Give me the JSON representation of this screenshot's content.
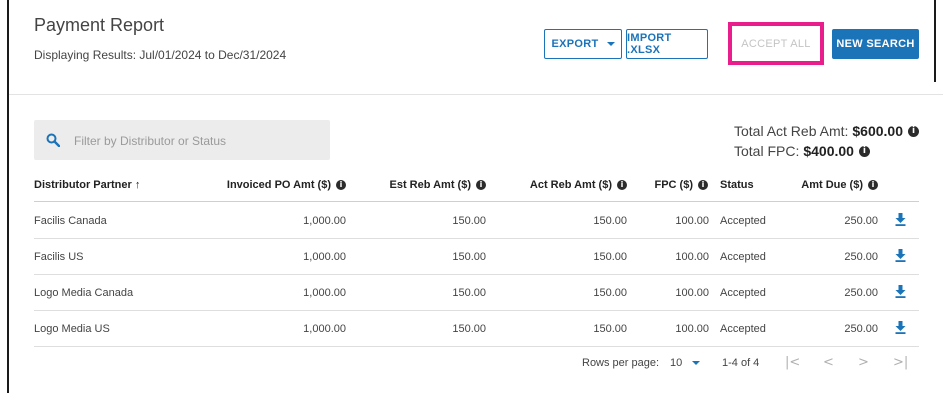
{
  "header": {
    "title": "Payment Report",
    "subtitle": "Displaying Results: Jul/01/2024 to Dec/31/2024"
  },
  "toolbar": {
    "export_label": "EXPORT",
    "import_label": "IMPORT .XLSX",
    "accept_all_label": "ACCEPT ALL",
    "new_search_label": "NEW SEARCH"
  },
  "search": {
    "placeholder": "Filter by Distributor or Status"
  },
  "totals": {
    "act_reb_label": "Total Act Reb Amt:",
    "act_reb_value": "$600.00",
    "fpc_label": "Total FPC:",
    "fpc_value": "$400.00"
  },
  "table": {
    "columns": [
      "Distributor Partner ↑",
      "Invoiced PO Amt ($)",
      "Est Reb Amt ($)",
      "Act Reb Amt ($)",
      "FPC ($)",
      "Status",
      "Amt Due ($)"
    ],
    "rows": [
      [
        "Facilis Canada",
        "1,000.00",
        "150.00",
        "150.00",
        "100.00",
        "Accepted",
        "250.00"
      ],
      [
        "Facilis US",
        "1,000.00",
        "150.00",
        "150.00",
        "100.00",
        "Accepted",
        "250.00"
      ],
      [
        "Logo Media Canada",
        "1,000.00",
        "150.00",
        "150.00",
        "100.00",
        "Accepted",
        "250.00"
      ],
      [
        "Logo Media US",
        "1,000.00",
        "150.00",
        "150.00",
        "100.00",
        "Accepted",
        "250.00"
      ]
    ]
  },
  "pagination": {
    "rows_per_page_label": "Rows per page:",
    "rows_per_page_value": "10",
    "range_text": "1-4 of 4"
  },
  "colors": {
    "accent": "#1b73b8",
    "highlight": "#e91e8c"
  },
  "icons": [
    "search-icon",
    "info-icon",
    "download-icon",
    "chevron-down-icon",
    "first-page-icon",
    "prev-page-icon",
    "next-page-icon",
    "last-page-icon"
  ]
}
